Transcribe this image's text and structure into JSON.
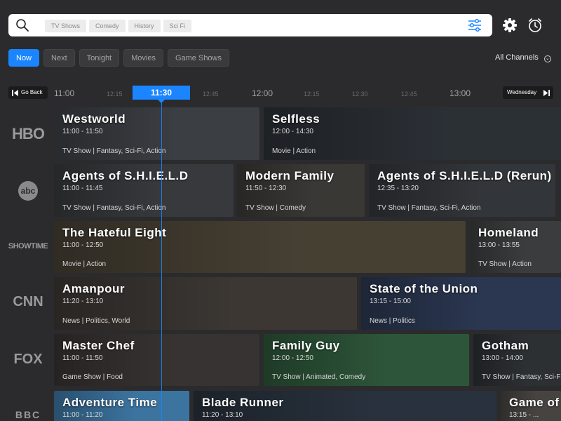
{
  "search": {
    "chips": [
      "TV Shows",
      "Comedy",
      "History",
      "Sci Fi"
    ]
  },
  "tabs": [
    {
      "label": "Now",
      "active": true
    },
    {
      "label": "Next",
      "active": false
    },
    {
      "label": "Tonight",
      "active": false
    },
    {
      "label": "Movies",
      "active": false
    },
    {
      "label": "Game Shows",
      "active": false
    }
  ],
  "channel_filter": "All Channels",
  "timeline": {
    "go_back": "Go Back",
    "day": "Wednesday",
    "ticks": [
      "11:00",
      "12:15",
      "11:30",
      "12:45",
      "12:00",
      "12:15",
      "12:30",
      "12:45",
      "13:00"
    ],
    "current": "11:30"
  },
  "channels": [
    {
      "logo": "HBO",
      "programs": [
        {
          "title": "Westworld",
          "time": "11:00 - 11:50",
          "genre": "TV Show | Fantasy, Sci-Fi, Action",
          "color": "#3e4146"
        },
        {
          "title": "Selfless",
          "time": "12:00 - 14:30",
          "genre": "Movie | Action",
          "color": "#2d3238"
        }
      ]
    },
    {
      "logo": "abc",
      "programs": [
        {
          "title": "Agents of S.H.I.E.L.D",
          "time": "11:00 - 11:45",
          "genre": "TV Show | Fantasy, Sci-Fi, Action",
          "color": "#3a3c3f"
        },
        {
          "title": "Modern Family",
          "time": "11:50 - 12:30",
          "genre": "TV Show | Comedy",
          "color": "#3d3b38"
        },
        {
          "title": "Agents of S.H.I.E.L.D (Rerun)",
          "time": "12:35 - 13:20",
          "genre": "TV Show | Fantasy, Sci-Fi, Action",
          "color": "#35383c"
        }
      ]
    },
    {
      "logo": "SHOWTIME",
      "programs": [
        {
          "title": "The Hateful Eight",
          "time": "11:00 - 12:50",
          "genre": "Movie | Action",
          "color": "#4a4336"
        },
        {
          "title": "Homeland",
          "time": "13:00 - 13:55",
          "genre": "TV Show | Action",
          "color": "#3e3f40"
        }
      ]
    },
    {
      "logo": "CNN",
      "programs": [
        {
          "title": "Amanpour",
          "time": "11:20 - 13:10",
          "genre": "News | Politics, World",
          "color": "#3f3a36"
        },
        {
          "title": "State of the Union",
          "time": "13:15 - 15:00",
          "genre": "News | Politics",
          "color": "#2d3a55"
        }
      ]
    },
    {
      "logo": "FOX",
      "programs": [
        {
          "title": "Master Chef",
          "time": "11:00 - 11:50",
          "genre": "Game Show | Food",
          "color": "#3a3634"
        },
        {
          "title": "Family Guy",
          "time": "12:00 - 12:50",
          "genre": "TV Show | Animated, Comedy",
          "color": "#2f5a3c"
        },
        {
          "title": "Gotham",
          "time": "13:00 - 14:00",
          "genre": "TV Show | Fantasy, Sci-Fi, Action",
          "color": "#2e3236"
        }
      ]
    },
    {
      "logo": "BBC",
      "programs": [
        {
          "title": "Adventure Time",
          "time": "11:00 - 11:20",
          "genre": "",
          "color": "#3f7aa8"
        },
        {
          "title": "Blade Runner",
          "time": "11:20 - 13:10",
          "genre": "",
          "color": "#2a3440"
        },
        {
          "title": "Game of",
          "time": "13:15 - ...",
          "genre": "",
          "color": "#4a4744"
        }
      ]
    }
  ],
  "colors": {
    "accent": "#1a85ff",
    "background": "#2b2b2d"
  }
}
